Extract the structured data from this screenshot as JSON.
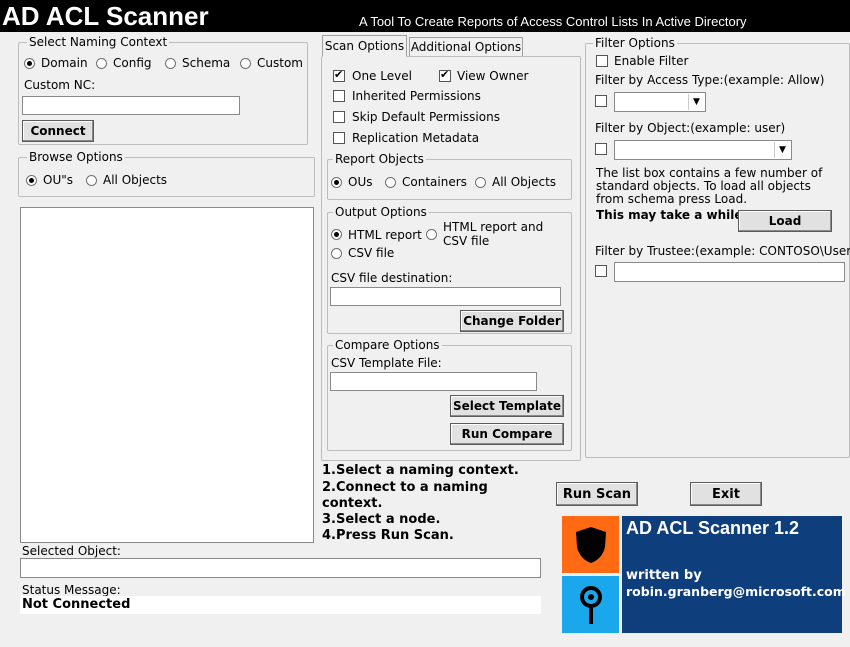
{
  "header": {
    "title": "AD ACL Scanner",
    "subtitle": "A Tool To Create Reports of Access Control Lists In Active Directory"
  },
  "naming_context": {
    "legend": "Select Naming Context",
    "options": [
      "Domain",
      "Config",
      "Schema",
      "Custom"
    ],
    "selected": "Domain",
    "custom_nc_label": "Custom NC:",
    "custom_nc_value": "",
    "connect_label": "Connect"
  },
  "browse": {
    "legend": "Browse Options",
    "options": [
      "OU\"s",
      "All Objects"
    ],
    "selected": "OU\"s"
  },
  "tabs": [
    {
      "label": "Scan Options",
      "active": true
    },
    {
      "label": "Additional Options",
      "active": false
    }
  ],
  "scan_options": {
    "one_level": {
      "label": "One Level",
      "checked": true
    },
    "view_owner": {
      "label": "View Owner",
      "checked": true
    },
    "inherited": {
      "label": "Inherited Permissions",
      "checked": false
    },
    "skip_default": {
      "label": "Skip Default Permissions",
      "checked": false
    },
    "replication": {
      "label": "Replication Metadata",
      "checked": false
    }
  },
  "report_objects": {
    "legend": "Report Objects",
    "options": [
      "OUs",
      "Containers",
      "All Objects"
    ],
    "selected": "OUs"
  },
  "output_options": {
    "legend": "Output Options",
    "html_report": "HTML report",
    "html_and_csv": "HTML report and CSV file",
    "csv_file": "CSV file",
    "selected": "HTML report",
    "csv_dest_label": "CSV file destination:",
    "csv_dest_value": "",
    "change_folder": "Change Folder"
  },
  "compare_options": {
    "legend": "Compare Options",
    "template_label": "CSV Template File:",
    "template_value": "",
    "select_template": "Select Template",
    "run_compare": "Run Compare"
  },
  "filter": {
    "legend": "Filter Options",
    "enable_label": "Enable Filter",
    "access_type_label": "Filter by Access Type:(example: Allow)",
    "object_label": "Filter by Object:(example: user)",
    "info_text": "The list box contains a few  number of standard objects. To load all objects from schema press Load.",
    "warning": "This may take a while!",
    "load_label": "Load",
    "trustee_label": "Filter by Trustee:(example: CONTOSO\\User)"
  },
  "instructions": [
    "1.Select a naming context.",
    "2.Connect to a naming context.",
    "3.Select a node.",
    "4.Press Run Scan."
  ],
  "run_scan": "Run Scan",
  "exit": "Exit",
  "about": {
    "title": "AD ACL Scanner 1.2",
    "written_by": "written by",
    "email": "robin.granberg@microsoft.com"
  },
  "selected_object": {
    "label": "Selected Object:",
    "value": ""
  },
  "status": {
    "label": "Status Message:",
    "value": "Not Connected"
  },
  "colors": {
    "about_bg": "#0f3e7c",
    "icon_orange": "#ff6a13",
    "icon_blue": "#1aa7ec"
  }
}
